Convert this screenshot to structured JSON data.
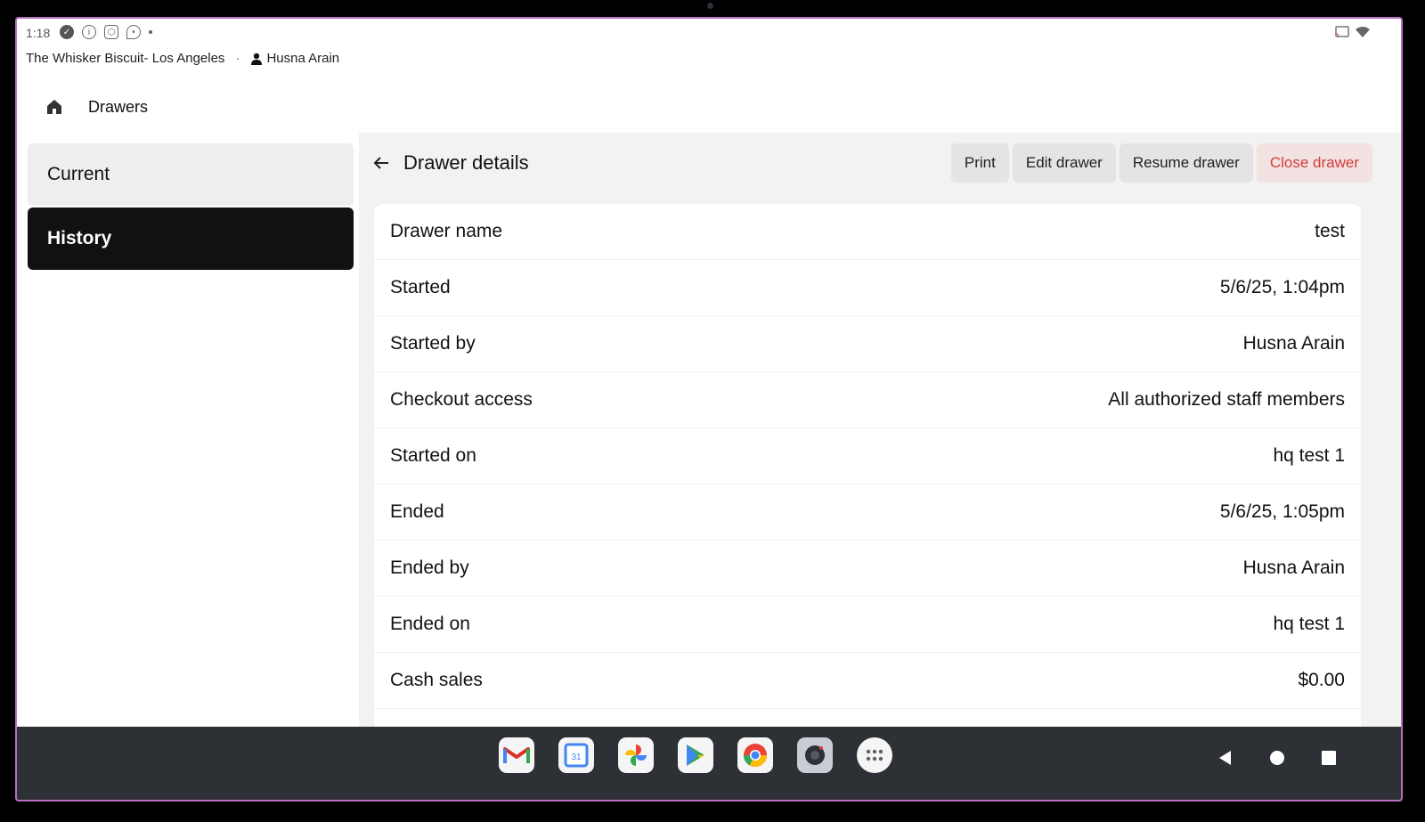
{
  "status_bar": {
    "time": "1:18",
    "icons": [
      "check-circle-icon",
      "info-icon",
      "shield-icon",
      "location-icon",
      "dot-icon"
    ],
    "right_icons": [
      "cast-icon",
      "wifi-icon"
    ]
  },
  "header": {
    "store_name": "The Whisker Biscuit- Los Angeles",
    "separator": "·",
    "user_name": "Husna Arain",
    "nav_title": "Drawers"
  },
  "sidebar": {
    "items": [
      {
        "label": "Current",
        "active": false
      },
      {
        "label": "History",
        "active": true
      }
    ]
  },
  "content": {
    "title": "Drawer details",
    "actions": {
      "print": "Print",
      "edit": "Edit drawer",
      "resume": "Resume drawer",
      "close": "Close drawer"
    },
    "details": [
      {
        "label": "Drawer name",
        "value": "test"
      },
      {
        "label": "Started",
        "value": "5/6/25, 1:04pm"
      },
      {
        "label": "Started by",
        "value": "Husna Arain"
      },
      {
        "label": "Checkout access",
        "value": "All authorized staff members"
      },
      {
        "label": "Started on",
        "value": "hq test 1"
      },
      {
        "label": "Ended",
        "value": "5/6/25, 1:05pm"
      },
      {
        "label": "Ended by",
        "value": "Husna Arain"
      },
      {
        "label": "Ended on",
        "value": "hq test 1"
      },
      {
        "label": "Cash sales",
        "value": "$0.00"
      }
    ]
  },
  "taskbar": {
    "apps": [
      "gmail-icon",
      "calendar-icon",
      "photos-icon",
      "play-store-icon",
      "chrome-icon",
      "camera-icon",
      "app-drawer-icon"
    ],
    "calendar_day": "31",
    "nav": [
      "back-nav-icon",
      "home-nav-icon",
      "recents-nav-icon"
    ]
  },
  "colors": {
    "accent_danger": "#d43b3b",
    "active_bg": "#111111",
    "frame_border": "#b86fc0"
  }
}
